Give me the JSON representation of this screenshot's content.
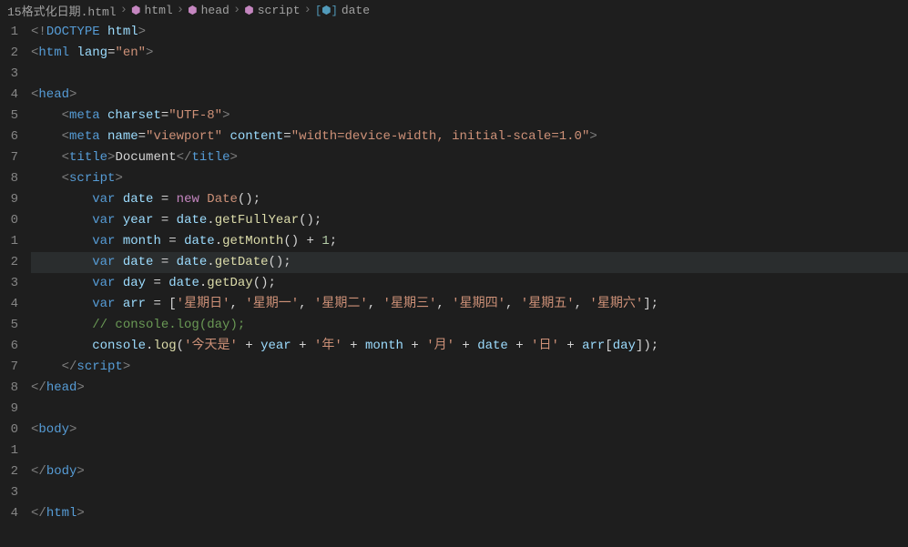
{
  "breadcrumb": {
    "file": "15格式化日期.html",
    "path": [
      "html",
      "head",
      "script",
      "date"
    ]
  },
  "gutter": [
    "1",
    "2",
    "3",
    "4",
    "5",
    "6",
    "7",
    "8",
    "9",
    "0",
    "1",
    "2",
    "3",
    "4",
    "5",
    "6",
    "7",
    "8",
    "9",
    "0",
    "1",
    "2",
    "3",
    "4"
  ],
  "code": {
    "l1": {
      "a": "<!",
      "b": "DOCTYPE",
      "c": " ",
      "d": "html",
      "e": ">"
    },
    "l2": {
      "a": "<",
      "b": "html",
      "c": " ",
      "d": "lang",
      "e": "=",
      "f": "\"en\"",
      "g": ">"
    },
    "l4": {
      "a": "<",
      "b": "head",
      "c": ">"
    },
    "l5": {
      "a": "<",
      "b": "meta",
      "c": " ",
      "d": "charset",
      "e": "=",
      "f": "\"UTF-8\"",
      "g": ">"
    },
    "l6": {
      "a": "<",
      "b": "meta",
      "c": " ",
      "d": "name",
      "e": "=",
      "f": "\"viewport\"",
      "g": " ",
      "h": "content",
      "i": "=",
      "j": "\"width=device-width, initial-scale=1.0\"",
      "k": ">"
    },
    "l7": {
      "a": "<",
      "b": "title",
      "c": ">",
      "d": "Document",
      "e": "</",
      "f": "title",
      "g": ">"
    },
    "l8": {
      "a": "<",
      "b": "script",
      "c": ">"
    },
    "l9": {
      "a": "var",
      "b": " ",
      "c": "date",
      "d": " = ",
      "e": "new",
      "f": " ",
      "g": "Date",
      "h": "();"
    },
    "l10": {
      "a": "var",
      "b": " ",
      "c": "year",
      "d": " = ",
      "e": "date",
      "f": ".",
      "g": "getFullYear",
      "h": "();"
    },
    "l11": {
      "a": "var",
      "b": " ",
      "c": "month",
      "d": " = ",
      "e": "date",
      "f": ".",
      "g": "getMonth",
      "h": "() + ",
      "i": "1",
      "j": ";"
    },
    "l12": {
      "a": "var",
      "b": " ",
      "c": "date",
      "d": " = ",
      "e": "date",
      "f": ".",
      "g": "getDate",
      "h": "();"
    },
    "l13": {
      "a": "var",
      "b": " ",
      "c": "day",
      "d": " = ",
      "e": "date",
      "f": ".",
      "g": "getDay",
      "h": "();"
    },
    "l14": {
      "a": "var",
      "b": " ",
      "c": "arr",
      "d": " = [",
      "e": "'星期日'",
      "f": ", ",
      "g": "'星期一'",
      "h": ", ",
      "i": "'星期二'",
      "j": ", ",
      "k": "'星期三'",
      "l": ", ",
      "m": "'星期四'",
      "n": ", ",
      "o": "'星期五'",
      "p": ", ",
      "q": "'星期六'",
      "r": "];"
    },
    "l15": {
      "a": "// console.log(day);"
    },
    "l16": {
      "a": "console",
      "b": ".",
      "c": "log",
      "d": "(",
      "e": "'今天是'",
      "f": " + ",
      "g": "year",
      "h": " + ",
      "i": "'年'",
      "j": " + ",
      "k": "month",
      "l": " + ",
      "m": "'月'",
      "n": " + ",
      "o": "date",
      "p": " + ",
      "q": "'日'",
      "r": " + ",
      "s": "arr",
      "t": "[",
      "u": "day",
      "v": "]);"
    },
    "l17": {
      "a": "</",
      "b": "script",
      "c": ">"
    },
    "l18": {
      "a": "</",
      "b": "head",
      "c": ">"
    },
    "l20": {
      "a": "<",
      "b": "body",
      "c": ">"
    },
    "l22": {
      "a": "</",
      "b": "body",
      "c": ">"
    },
    "l24": {
      "a": "</",
      "b": "html",
      "c": ">"
    }
  }
}
